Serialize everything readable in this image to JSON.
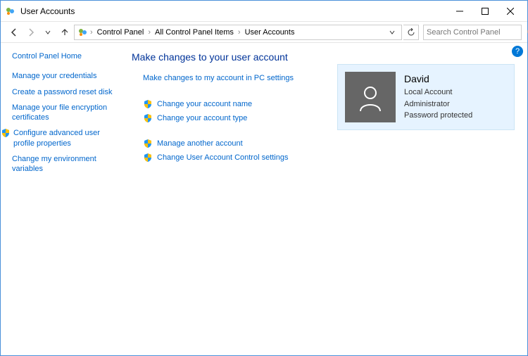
{
  "window": {
    "title": "User Accounts"
  },
  "breadcrumbs": [
    "Control Panel",
    "All Control Panel Items",
    "User Accounts"
  ],
  "search": {
    "placeholder": "Search Control Panel"
  },
  "sidebar": {
    "home": "Control Panel Home",
    "items": [
      "Manage your credentials",
      "Create a password reset disk",
      "Manage your file encryption certificates",
      "Configure advanced user profile properties",
      "Change my environment variables"
    ]
  },
  "main": {
    "heading": "Make changes to your user account",
    "links": {
      "pc_settings": "Make changes to my account in PC settings",
      "change_name": "Change your account name",
      "change_type": "Change your account type",
      "manage_another": "Manage another account",
      "change_uac": "Change User Account Control settings"
    }
  },
  "account": {
    "name": "David",
    "type": "Local Account",
    "role": "Administrator",
    "password": "Password protected"
  }
}
